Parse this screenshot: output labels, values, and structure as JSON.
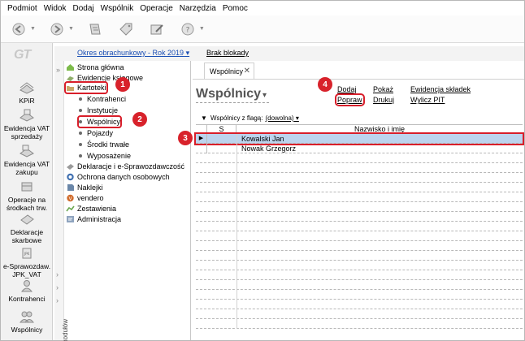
{
  "menu": [
    "Podmiot",
    "Widok",
    "Dodaj",
    "Wspólnik",
    "Operacje",
    "Narzędzia",
    "Pomoc"
  ],
  "toolbar": {
    "buttons": [
      {
        "icon": "back-icon",
        "has_dropdown": true
      },
      {
        "icon": "forward-icon",
        "has_dropdown": true
      },
      {
        "icon": "document-icon",
        "has_dropdown": false
      },
      {
        "icon": "tag-icon",
        "has_dropdown": false
      },
      {
        "icon": "edit-icon",
        "has_dropdown": false
      },
      {
        "icon": "help-icon",
        "has_dropdown": true
      }
    ]
  },
  "quickbar": {
    "logo": "GT",
    "items": [
      {
        "label": "KPiR",
        "icon": "book-icon"
      },
      {
        "label": "Ewidencja VAT sprzedaży",
        "icon": "vat-sales-icon"
      },
      {
        "label": "Ewidencja VAT zakupu",
        "icon": "vat-purchase-icon"
      },
      {
        "label": "Operacje na środkach trw.",
        "icon": "fixed-assets-icon"
      },
      {
        "label": "Deklaracje skarbowe",
        "icon": "declarations-icon"
      },
      {
        "label": "e-Sprawozdaw. JPK_VAT",
        "icon": "jpk-icon"
      },
      {
        "label": "Kontrahenci",
        "icon": "contractors-icon"
      },
      {
        "label": "Wspólnicy",
        "icon": "partners-icon"
      }
    ]
  },
  "period": {
    "label": "Okres obrachunkowy - Rok 2019",
    "lock": "Brak blokady"
  },
  "tree": {
    "side_label": "a modułów",
    "nodes": [
      {
        "label": "Strona główna",
        "level": 0,
        "icon": "home-icon"
      },
      {
        "label": "Ewidencje księgowe",
        "level": 0,
        "icon": "ledger-icon"
      },
      {
        "label": "Kartoteki",
        "level": 0,
        "icon": "folder-icon",
        "highlight": true
      },
      {
        "label": "Kontrahenci",
        "level": 1
      },
      {
        "label": "Instytucje",
        "level": 1
      },
      {
        "label": "Wspólnicy",
        "level": 1,
        "highlight": true
      },
      {
        "label": "Pojazdy",
        "level": 1
      },
      {
        "label": "Środki trwałe",
        "level": 1
      },
      {
        "label": "Wyposażenie",
        "level": 1
      },
      {
        "label": "Deklaracje i e-Sprawozdawczość",
        "level": 0,
        "icon": "declaration-icon"
      },
      {
        "label": "Ochrona danych osobowych",
        "level": 0,
        "icon": "shield-icon"
      },
      {
        "label": "Naklejki",
        "level": 0,
        "icon": "sticker-icon"
      },
      {
        "label": "vendero",
        "level": 0,
        "icon": "vendero-icon"
      },
      {
        "label": "Zestawienia",
        "level": 0,
        "icon": "report-icon"
      },
      {
        "label": "Administracja",
        "level": 0,
        "icon": "admin-icon"
      }
    ]
  },
  "badges": [
    "1",
    "2",
    "3",
    "4"
  ],
  "main": {
    "tab": "Wspólnicy",
    "tab_close": "✕",
    "title": "Wspólnicy",
    "actions": {
      "dodaj": "Dodaj",
      "popraw": "Popraw",
      "pokaz": "Pokaż",
      "drukuj": "Drukuj",
      "ewidencja": "Ewidencja składek",
      "wylicz": "Wylicz PIT"
    },
    "flag_label": "Wspólnicy z flagą:",
    "flag_value": "(dowolna)",
    "columns": [
      "S",
      "Nazwisko i imię"
    ],
    "rows": [
      {
        "name": "Kowalski Jan",
        "selected": true
      },
      {
        "name": "Nowak Grzegorz",
        "selected": false
      }
    ]
  },
  "colors": {
    "accent_red": "#d81e2a",
    "selection": "#bcd4ee",
    "link_blue": "#1a4fb4"
  }
}
